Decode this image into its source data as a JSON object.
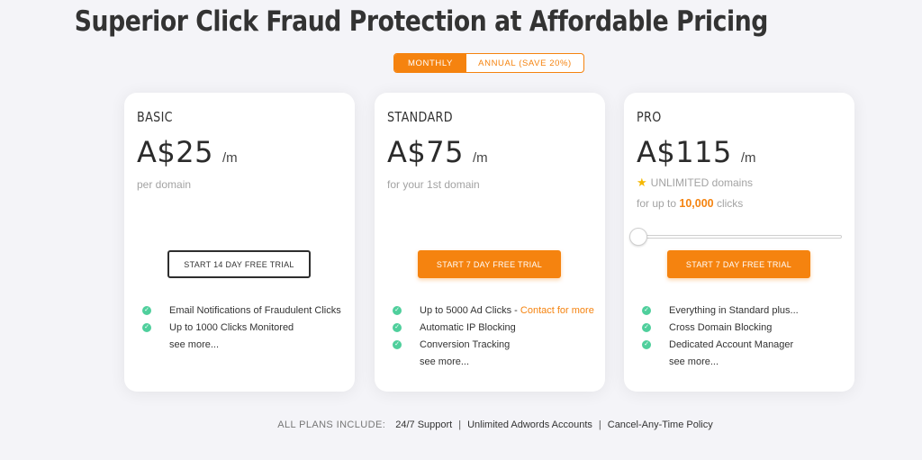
{
  "header": {
    "title": "Superior Click Fraud Protection at Affordable Pricing"
  },
  "billing_toggle": {
    "monthly": "MONTHLY",
    "annual": "ANNUAL (SAVE 20%)",
    "selected": "monthly"
  },
  "plans": [
    {
      "name": "BASIC",
      "price": "A$25",
      "period": "/m",
      "subtitle": "per domain",
      "cta": "START 14 DAY FREE TRIAL",
      "features": [
        "Email Notifications of Fraudulent Clicks",
        "Up to 1000 Clicks Monitored"
      ],
      "see_more": "see more..."
    },
    {
      "name": "STANDARD",
      "price": "A$75",
      "period": "/m",
      "subtitle": "for your 1st domain",
      "cta": "START 7 DAY FREE TRIAL",
      "features": [
        "Up to 5000 Ad Clicks - ",
        "Automatic IP Blocking",
        "Conversion Tracking"
      ],
      "feature_link": "Contact for more",
      "see_more": "see more..."
    },
    {
      "name": "PRO",
      "price": "A$115",
      "period": "/m",
      "domains_label": "UNLIMITED domains",
      "clicks_prefix": "for up to",
      "clicks_value": "10,000",
      "clicks_suffix": "clicks",
      "slider_value": 0,
      "cta": "START 7 DAY FREE TRIAL",
      "features": [
        "Everything in Standard plus...",
        "Cross Domain Blocking",
        "Dedicated Account Manager"
      ],
      "see_more": "see more..."
    }
  ],
  "footer": {
    "lead": "ALL PLANS INCLUDE:",
    "items": [
      "24/7 Support",
      "Unlimited Adwords Accounts",
      "Cancel-Any-Time Policy"
    ]
  },
  "colors": {
    "accent": "#f5830f",
    "check": "#4fcf9c",
    "star": "#f5b800",
    "background": "#f4f4f8"
  }
}
